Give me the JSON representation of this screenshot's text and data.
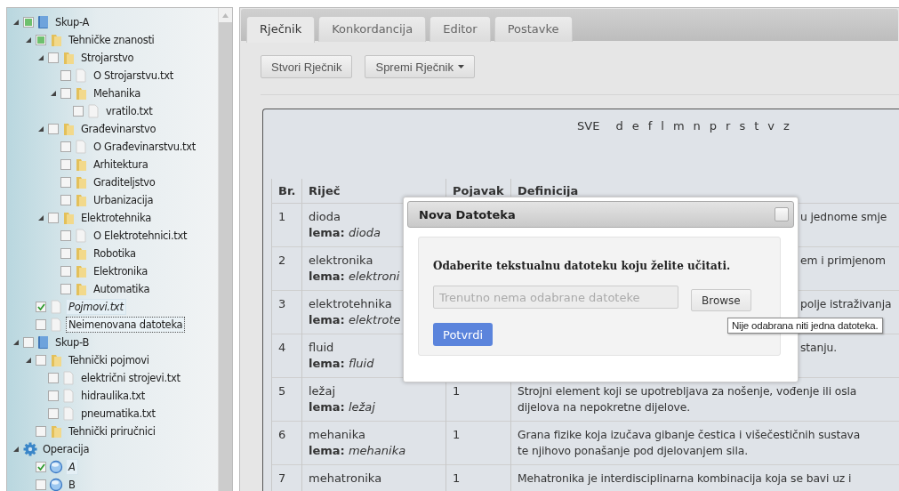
{
  "tree": [
    {
      "kind": "set",
      "label": "Skup-A",
      "checked": false,
      "partial": true,
      "expanded": true,
      "children": [
        {
          "kind": "folder",
          "label": "Tehničke znanosti",
          "checked": false,
          "partial": true,
          "expanded": true,
          "children": [
            {
              "kind": "folder",
              "label": "Strojarstvo",
              "checked": false,
              "expanded": true,
              "children": [
                {
                  "kind": "file",
                  "label": "O Strojarstvu.txt",
                  "checked": false
                },
                {
                  "kind": "folder",
                  "label": "Mehanika",
                  "checked": false,
                  "expanded": true,
                  "children": [
                    {
                      "kind": "file",
                      "label": "vratilo.txt",
                      "checked": false
                    }
                  ]
                }
              ]
            },
            {
              "kind": "folder",
              "label": "Građevinarstvo",
              "checked": false,
              "expanded": true,
              "children": [
                {
                  "kind": "file",
                  "label": "O Građevinarstvu.txt",
                  "checked": false
                },
                {
                  "kind": "folder",
                  "label": "Arhitektura",
                  "checked": false
                },
                {
                  "kind": "folder",
                  "label": "Graditeljstvo",
                  "checked": false
                },
                {
                  "kind": "folder",
                  "label": "Urbanizacija",
                  "checked": false
                }
              ]
            },
            {
              "kind": "folder",
              "label": "Elektrotehnika",
              "checked": false,
              "expanded": true,
              "children": [
                {
                  "kind": "file",
                  "label": "O Elektrotehnici.txt",
                  "checked": false
                },
                {
                  "kind": "folder",
                  "label": "Robotika",
                  "checked": false
                },
                {
                  "kind": "folder",
                  "label": "Elektronika",
                  "checked": false
                },
                {
                  "kind": "folder",
                  "label": "Automatika",
                  "checked": false
                }
              ]
            }
          ]
        },
        {
          "kind": "file",
          "label": "Pojmovi.txt",
          "checked": true,
          "active": true,
          "selected": false
        },
        {
          "kind": "file",
          "label": "Neimenovana datoteka",
          "checked": false,
          "active": false,
          "selected": true
        }
      ]
    },
    {
      "kind": "set",
      "label": "Skup-B",
      "checked": false,
      "expanded": true,
      "children": [
        {
          "kind": "folder",
          "label": "Tehnički pojmovi",
          "checked": false,
          "expanded": true,
          "children": [
            {
              "kind": "file",
              "label": "električni strojevi.txt",
              "checked": false
            },
            {
              "kind": "file",
              "label": "hidraulika.txt",
              "checked": false
            },
            {
              "kind": "file",
              "label": "pneumatika.txt",
              "checked": false
            }
          ]
        },
        {
          "kind": "folder",
          "label": "Tehnički priručnici",
          "checked": false
        }
      ]
    },
    {
      "kind": "gear",
      "label": "Operacija",
      "expanded": true,
      "children": [
        {
          "kind": "sphere",
          "label": "A",
          "checked": true,
          "active": true
        },
        {
          "kind": "sphere",
          "label": "B",
          "checked": false,
          "active": false
        }
      ]
    }
  ],
  "tabs": [
    {
      "label": "Rječnik",
      "selected": true
    },
    {
      "label": "Konkordancija",
      "selected": false
    },
    {
      "label": "Editor",
      "selected": false
    },
    {
      "label": "Postavke",
      "selected": false
    }
  ],
  "buttons": [
    {
      "label": "Stvori Rječnik",
      "kind": "plain"
    },
    {
      "label": "Spremi Rječnik",
      "kind": "dropdown"
    }
  ],
  "letters": [
    "SVE",
    "d",
    "e",
    "f",
    "l",
    "m",
    "n",
    "p",
    "r",
    "s",
    "t",
    "v",
    "z"
  ],
  "table": {
    "columns": [
      "Br.",
      "Riječ",
      "Pojavak",
      "Definicija"
    ],
    "rows": [
      {
        "kind": "covered",
        "number": "1",
        "word": "dioda",
        "lemma": "**lema:** *dioda*",
        "definition": [
          "u jednome smje"
        ]
      },
      {
        "kind": "covered",
        "number": "2",
        "word": "elektronika",
        "lemma": "**lema:** *elektroni*",
        "definition": [
          "em i primjenom"
        ]
      },
      {
        "kind": "covered",
        "number": "3",
        "word": "elektrotehnika",
        "lemma": "**lema:** *elektrote*",
        "definition": [
          "polje istraživanja"
        ]
      },
      {
        "kind": "covered",
        "number": "4",
        "word": "fluid",
        "lemma": "**lema:** *fluid*",
        "definition": [
          "stanju."
        ]
      },
      {
        "kind": "full",
        "number": "5",
        "word": "ležaj",
        "lemma": "**lema:** *ležaj*",
        "count": "1",
        "definition": [
          "Strojni element koji se upotrebljava za nošenje, vođenje ili osla",
          "dijelova na nepokretne dijelove."
        ]
      },
      {
        "kind": "full",
        "number": "6",
        "word": "mehanika",
        "lemma": "**lema:** *mehanika*",
        "count": "1",
        "definition": [
          "Grana fizike koja izučava gibanje čestica i višečestičnih sustava",
          "te njihovo ponašanje pod djelovanjem sila."
        ]
      },
      {
        "kind": "full",
        "number": "7",
        "word": "mehatronika",
        "count": "1",
        "definition": [
          "Mehatronika je interdisciplinarna kombinacija koja se bavi uz i"
        ]
      }
    ]
  },
  "modal": {
    "title": "Nova Datoteka",
    "prompt": "Odaberite tekstualnu datoteku koju želite učitati.",
    "file_field": {
      "placeholder": "Trenutno nema odabrane datoteke"
    },
    "browse": "Browse",
    "confirm": "Potvrdi",
    "tooltip": "Nije odabrana niti jedna datoteka."
  }
}
